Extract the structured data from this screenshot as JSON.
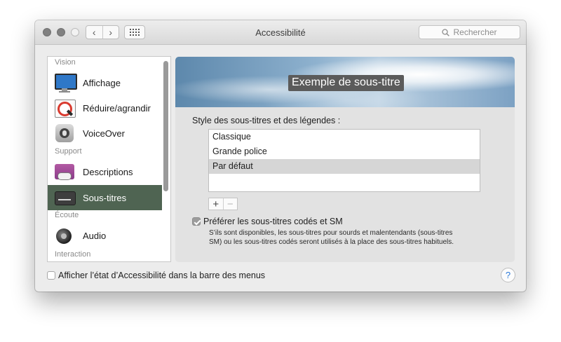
{
  "window": {
    "title": "Accessibilité"
  },
  "toolbar": {
    "search_placeholder": "Rechercher",
    "back_glyph": "‹",
    "forward_glyph": "›"
  },
  "sidebar": {
    "sections": {
      "vision": "Vision",
      "support": "Support",
      "ecoute": "Écoute",
      "interaction": "Interaction"
    },
    "items": [
      {
        "label": "Affichage",
        "icon": "display-icon"
      },
      {
        "label": "Réduire/agrandir",
        "icon": "zoom-icon"
      },
      {
        "label": "VoiceOver",
        "icon": "voiceover-icon"
      },
      {
        "label": "Descriptions",
        "icon": "descriptions-icon"
      },
      {
        "label": "Sous-titres",
        "icon": "captions-icon",
        "selected": true
      },
      {
        "label": "Audio",
        "icon": "speaker-icon"
      }
    ]
  },
  "content": {
    "preview_text": "Exemple de sous-titre",
    "style_label": "Style des sous-titres et des légendes :",
    "styles": [
      "Classique",
      "Grande police",
      "Par défaut"
    ],
    "selected_style": "Par défaut",
    "add_label": "+",
    "remove_label": "−",
    "prefer_label": "Préférer les sous-titres codés et SM",
    "prefer_checked": true,
    "prefer_desc_line1": "S’ils sont disponibles, les sous-titres pour sourds et malentendants (sous-titres",
    "prefer_desc_line2": "SM) ou les sous-titres codés seront utilisés à la place des sous-titres habituels."
  },
  "footer": {
    "menu_status_label": "Afficher l’état d’Accessibilité dans la barre des menus",
    "menu_status_checked": false,
    "help_label": "?"
  }
}
